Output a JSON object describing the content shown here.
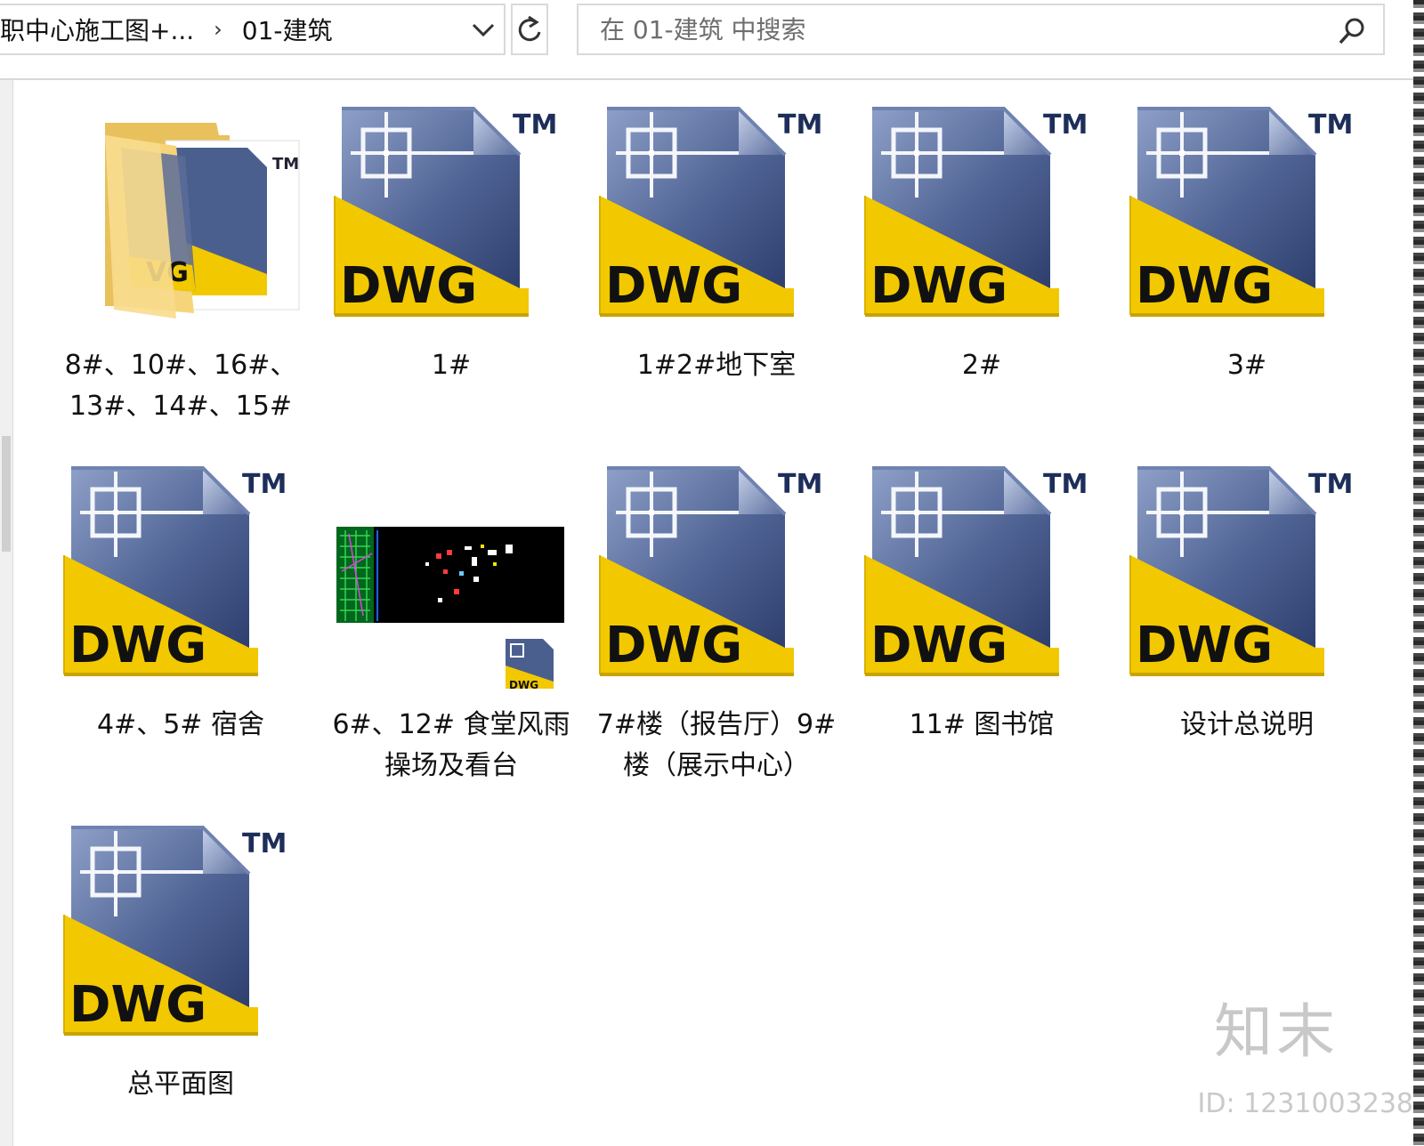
{
  "breadcrumb": {
    "parent": "职中心施工图+...",
    "separator": "›",
    "current": "01-建筑"
  },
  "toolbar": {
    "dropdown_icon": "chevron-down-icon",
    "refresh_icon": "refresh-icon"
  },
  "search": {
    "placeholder": "在 01-建筑 中搜索",
    "icon": "search-icon"
  },
  "files": [
    {
      "name": "8#、10#、16#、13#、14#、15#",
      "type": "folder"
    },
    {
      "name": "1#",
      "type": "dwg"
    },
    {
      "name": "1#2#地下室",
      "type": "dwg"
    },
    {
      "name": "2#",
      "type": "dwg"
    },
    {
      "name": "3#",
      "type": "dwg"
    },
    {
      "name": "4#、5# 宿舍",
      "type": "dwg"
    },
    {
      "name": "6#、12# 食堂风雨操场及看台",
      "type": "dwg-preview"
    },
    {
      "name": "7#楼（报告厅）9#楼（展示中心）",
      "type": "dwg"
    },
    {
      "name": "11# 图书馆",
      "type": "dwg"
    },
    {
      "name": "设计总说明",
      "type": "dwg"
    },
    {
      "name": "总平面图",
      "type": "dwg"
    }
  ],
  "dwg_icon_text": {
    "badge": "DWG",
    "tm": "TM"
  },
  "colors": {
    "dwg_blue_dark": "#2e3f6e",
    "dwg_blue_light": "#8ea0c8",
    "dwg_yellow": "#f2c800",
    "folder_yellow": "#f6d57a"
  },
  "watermark": {
    "logo": "知末",
    "id": "ID: 1231003238"
  }
}
